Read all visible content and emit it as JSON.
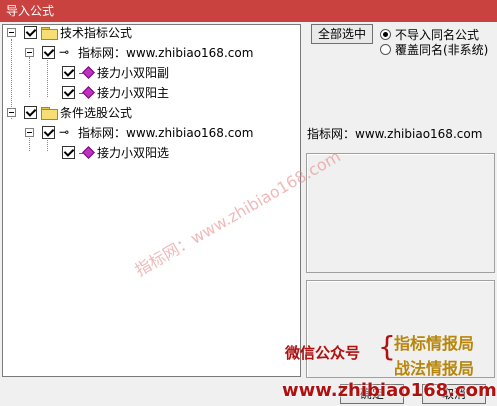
{
  "window": {
    "title": "导入公式"
  },
  "tree": {
    "indicator_group": {
      "label": "技术指标公式"
    },
    "indicator_source": {
      "label": "指标网：www.zhibiao168.com"
    },
    "indicator_items": [
      {
        "label": "接力小双阳副"
      },
      {
        "label": "接力小双阳主"
      }
    ],
    "screener_group": {
      "label": "条件选股公式"
    },
    "screener_source": {
      "label": "指标网：www.zhibiao168.com"
    },
    "screener_items": [
      {
        "label": "接力小双阳选"
      }
    ]
  },
  "right": {
    "select_all_label": "全部选中",
    "options": [
      {
        "label": "不导入同名公式",
        "selected": true
      },
      {
        "label": "覆盖同名(非系统)",
        "selected": false
      }
    ],
    "source_info": "指标网：www.zhibiao168.com"
  },
  "footer": {
    "ok_label": "确定",
    "cancel_label": "取消"
  },
  "watermark": {
    "diagonal_text": "指标网：www.zhibiao168.com",
    "wechat_label": "微信公众号",
    "brand_top": "指标情报局",
    "brand_bottom": "战法情报局",
    "url": "www.zhibiao168.com"
  },
  "colors": {
    "titlebar": "#c9423f",
    "checkmark_node": "#c02fc0",
    "promo_red": "#b01010",
    "promo_gold": "#b8860b"
  }
}
